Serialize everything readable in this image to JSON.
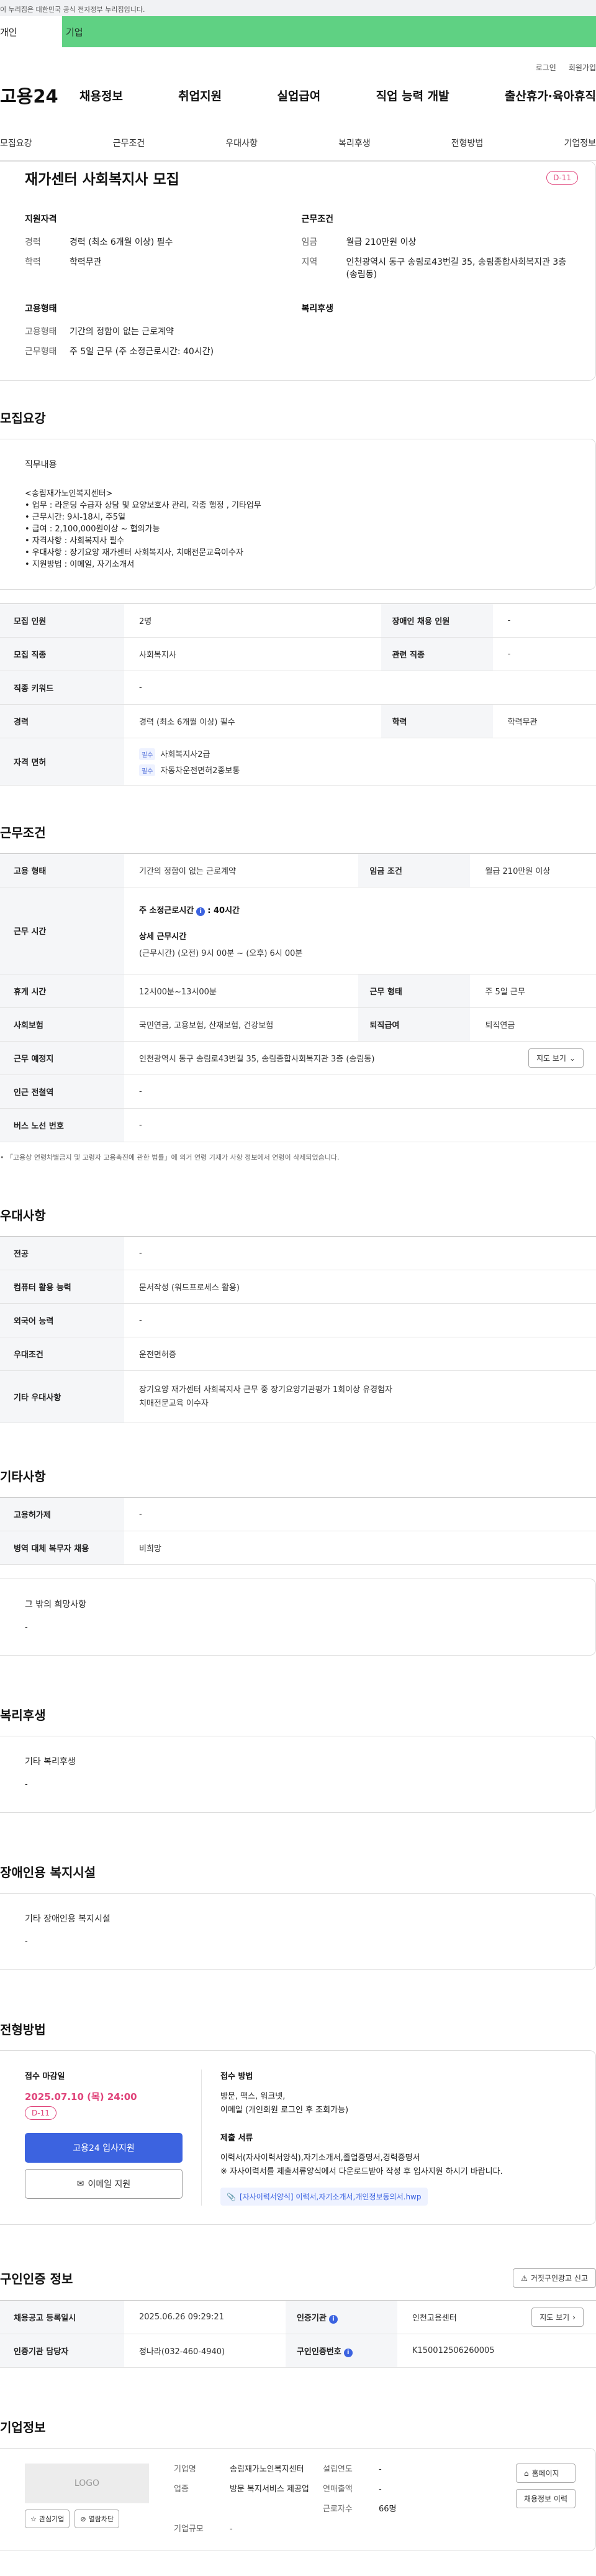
{
  "gov_banner": "이 누리집은 대한민국 공식 전자정부 누리집입니다.",
  "user_tabs": [
    "개인",
    "기업"
  ],
  "util": [
    "로그인",
    "회원가입"
  ],
  "logo": "고용24",
  "gnb": [
    "채용정보",
    "취업지원",
    "실업급여",
    "직업 능력 개발",
    "출산휴가·육아휴직"
  ],
  "snb": [
    "모집요강",
    "근무조건",
    "우대사항",
    "복리후생",
    "전형방법",
    "기업정보"
  ],
  "header": {
    "title": "재가센터 사회복지사 모집",
    "dday": "D-11",
    "qual_title": "지원자격",
    "qual": [
      {
        "k": "경력",
        "v": "경력 (최소 6개월 이상) 필수"
      },
      {
        "k": "학력",
        "v": "학력무관"
      }
    ],
    "cond_title": "근무조건",
    "cond": [
      {
        "k": "임금",
        "v": "월급 210만원 이상"
      },
      {
        "k": "지역",
        "v": "인천광역시 동구 송림로43번길 35, 송림종합사회복지관 3층 (송림동)"
      }
    ],
    "emp_title": "고용형태",
    "emp": [
      {
        "k": "고용형태",
        "v": "기간의 정함이 없는 근로계약"
      },
      {
        "k": "근무형태",
        "v": "주 5일 근무 (주 소정근로시간: 40시간)"
      }
    ],
    "welfare_title": "복리후생"
  },
  "recruit": {
    "title": "모집요강",
    "duty_title": "직무내용",
    "duty_lines": [
      "<송림재가노인복지센터>",
      "• 업무 : 라운딩 수급자 상담 및 요양보호사 관리, 각종 행정 , 기타업무",
      "• 근무시간: 9시-18시, 주5일",
      "• 급여 : 2,100,000원이상 ~ 협의가능",
      "• 자격사항 : 사회복지사 필수",
      "• 우대사항 : 장기요양 재가센터 사회복지사, 치매전문교육이수자",
      "• 지원방법 : 이메일, 자기소개서"
    ],
    "rows": [
      {
        "k": "모집 인원",
        "v": "2명",
        "k2": "장애인 채용 인원",
        "v2": "-"
      },
      {
        "k": "모집 직종",
        "v": "사회복지사",
        "k2": "관련 직종",
        "v2": "-"
      },
      {
        "k": "직종 키워드",
        "v": "-"
      },
      {
        "k": "경력",
        "v": "경력 (최소 6개월 이상) 필수",
        "k2": "학력",
        "v2": "학력무관"
      }
    ],
    "license_k": "자격 면허",
    "license_tag": "필수",
    "licenses": [
      "사회복지사2급",
      "자동차운전면허2종보통"
    ]
  },
  "work": {
    "title": "근무조건",
    "emp_k": "고용 형태",
    "emp_v": "기간의 정함이 없는 근로계약",
    "wage_k": "임금 조건",
    "wage_v": "월급 210만원 이상",
    "time_k": "근무 시간",
    "time_main": "주 소정근로시간",
    "time_hours": ": 40시간",
    "time_detail_title": "상세 근무시간",
    "time_detail": "(근무시간) (오전) 9시 00분 ~ (오후) 6시 00분",
    "break_k": "휴게 시간",
    "break_v": "12시00분~13시00분",
    "form_k": "근무 형태",
    "form_v": "주 5일 근무",
    "ins_k": "사회보험",
    "ins_v": "국민연금, 고용보험, 산재보험, 건강보험",
    "ret_k": "퇴직급여",
    "ret_v": "퇴직연금",
    "place_k": "근무 예정지",
    "place_v": "인천광역시 동구 송림로43번길 35, 송림종합사회복지관 3층 (송림동)",
    "map_btn": "지도 보기",
    "subway_k": "인근 전철역",
    "subway_v": "-",
    "bus_k": "버스 노선 번호",
    "bus_v": "-",
    "note": "「고용상 연령차별금지 및 고령자 고용촉진에 관한 법률」에 의거 연령 기재가 사항 정보에서 연령이 삭제되었습니다."
  },
  "pref": {
    "title": "우대사항",
    "rows": [
      {
        "k": "전공",
        "v": "-"
      },
      {
        "k": "컴퓨터 활용 능력",
        "v": "문서작성 (워드프로세스 활용)"
      },
      {
        "k": "외국어 능력",
        "v": "-"
      },
      {
        "k": "우대조건",
        "v": "운전면허증"
      },
      {
        "k": "기타 우대사항",
        "v": "장기요양 재가센터 사회복지사 근무 중 장기요양기관평가 1회이상 유경험자\n치매전문교육 이수자"
      }
    ]
  },
  "etc": {
    "title": "기타사항",
    "rows": [
      {
        "k": "고용허가제",
        "v": "-"
      },
      {
        "k": "병역 대체 복무자 채용",
        "v": "비희망"
      }
    ],
    "hope_title": "그 밖의 희망사항",
    "hope_v": "-"
  },
  "welfare": {
    "title": "복리후생",
    "box_title": "기타 복리후생",
    "box_v": "-"
  },
  "disabled": {
    "title": "장애인용 복지시설",
    "box_title": "기타 장애인용 복지시설",
    "box_v": "-"
  },
  "apply": {
    "title": "전형방법",
    "deadline_title": "접수 마감일",
    "deadline": "2025.07.10 (목) 24:00",
    "dday": "D-11",
    "apply_btn": "고용24 입사지원",
    "mail_btn": "이메일 지원",
    "method_title": "접수 방법",
    "method_v": "방문, 팩스, 워크넷,\n이메일 (개인회원 로그인 후 조회가능)",
    "docs_title": "제출 서류",
    "docs_v": "이력서(자사이력서양식),자기소개서,졸업증명서,경력증명서\n※ 자사이력서를 제출서류양식에서 다운로드받아 작성 후 입사지원 하시기 바랍니다.",
    "file": "[자사이력서양식] 이력서,자기소개서,개인정보동의서.hwp"
  },
  "cert": {
    "title": "구인인증 정보",
    "report_btn": "거짓구인광고 신고",
    "reg_k": "채용공고 등록일시",
    "reg_v": "2025.06.26 09:29:21",
    "org_k": "인증기관",
    "org_v": "인천고용센터",
    "map_btn": "지도 보기",
    "mgr_k": "인증기관 담당자",
    "mgr_v": "정나라(032-460-4940)",
    "no_k": "구인인증번호",
    "no_v": "K150012506260005"
  },
  "company": {
    "title": "기업정보",
    "logo": "LOGO",
    "interest_btn": "관심기업",
    "block_btn": "열람차단",
    "rows": [
      {
        "k": "기업명",
        "v": "송림재가노인복지센터",
        "k2": "설립연도",
        "v2": "-"
      },
      {
        "k": "업종",
        "v": "방문 복지서비스 제공업",
        "k2": "연매출액",
        "v2": "-"
      },
      {
        "k2": "근로자수",
        "v2": "66명"
      },
      {
        "k": "기업규모",
        "v": "-"
      }
    ],
    "home_btn": "홈페이지",
    "jobs_btn": "채용정보 이력"
  }
}
